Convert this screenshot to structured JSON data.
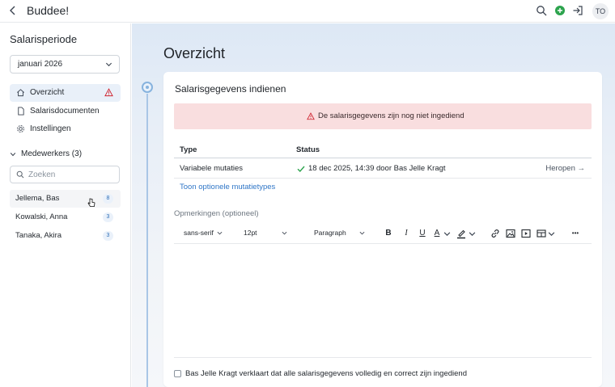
{
  "app": {
    "title": "Buddee!",
    "avatar_initials": "TO"
  },
  "colors": {
    "accent": "#2f76c7",
    "alert_bg": "#f9dedf",
    "success": "#2da44e",
    "warning": "#cf222e",
    "add_green": "#2da44e"
  },
  "sidebar": {
    "heading": "Salarisperiode",
    "period_value": "januari 2026",
    "nav": [
      {
        "label": "Overzicht",
        "icon": "home-icon",
        "active": true,
        "warning": true
      },
      {
        "label": "Salarisdocumenten",
        "icon": "document-icon",
        "active": false,
        "warning": false
      },
      {
        "label": "Instellingen",
        "icon": "gear-icon",
        "active": false,
        "warning": false
      }
    ],
    "employees_header": "Medewerkers (3)",
    "search_placeholder": "Zoeken",
    "employees": [
      {
        "name": "Jellema, Bas",
        "count": "8"
      },
      {
        "name": "Kowalski, Anna",
        "count": "3"
      },
      {
        "name": "Tanaka, Akira",
        "count": "3"
      }
    ]
  },
  "main": {
    "title": "Overzicht",
    "card_title": "Salarisgegevens indienen",
    "alert_text": "De salarisgegevens zijn nog niet ingediend",
    "table": {
      "headers": {
        "type": "Type",
        "status": "Status"
      },
      "row": {
        "type": "Variabele mutaties",
        "status": "18 dec 2025, 14:39 door Bas Jelle Kragt",
        "action": "Heropen →"
      }
    },
    "optional_link": "Toon optionele mutatietypes",
    "remarks_label": "Opmerkingen (optioneel)",
    "toolbar": {
      "font": "sans-serif",
      "size": "12pt",
      "block": "Paragraph",
      "bold": "B",
      "italic": "I",
      "underline": "U",
      "text_color": "A",
      "more": "•••"
    },
    "declaration": "Bas Jelle Kragt verklaart dat alle salarisgegevens volledig en correct zijn ingediend"
  }
}
